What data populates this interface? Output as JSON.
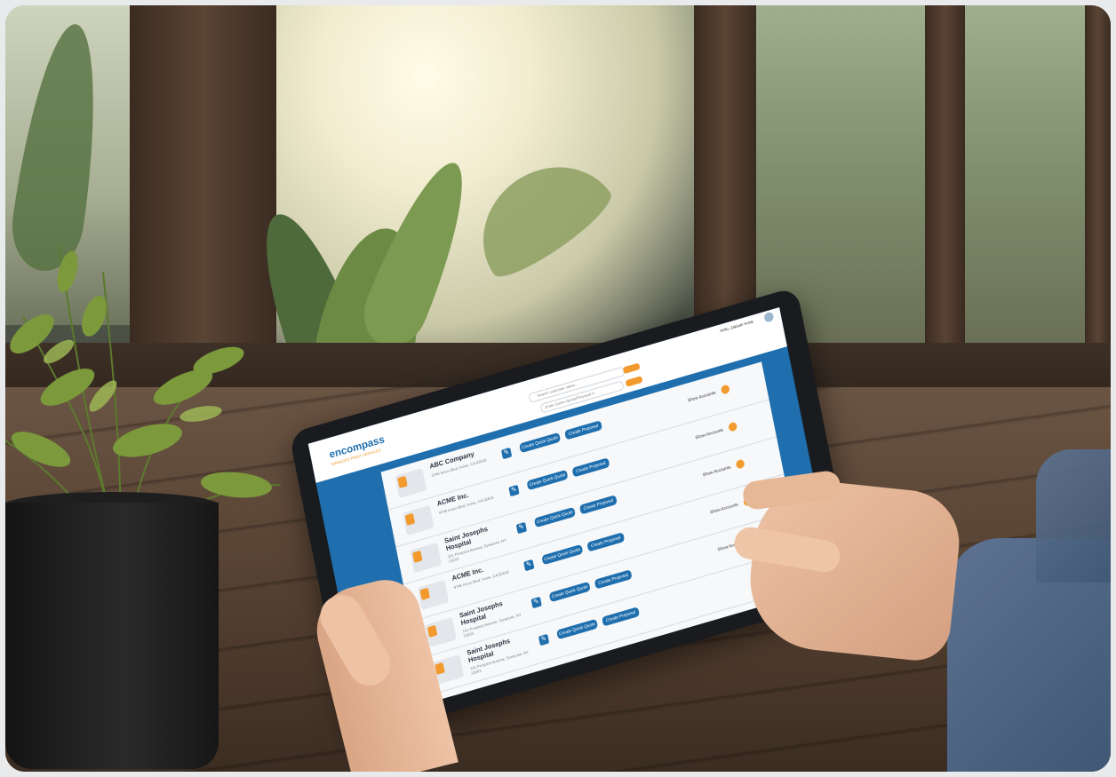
{
  "app": {
    "logo_text": "encompass",
    "logo_tagline": "MANAGED PRINT SERVICES",
    "greeting": "Hello, Zakiyah Holds",
    "search_placeholder": "Search customer name...",
    "quote_placeholder": "Enter Quote Quote/Proposal #..."
  },
  "customers": [
    {
      "name": "ABC Company",
      "address": "3745 Innox Blvd, Irvine, CA 92618"
    },
    {
      "name": "ACME Inc.",
      "address": "9745 Innox Blvd, Irvine, CA 92618"
    },
    {
      "name": "Saint Josephs Hospital",
      "address": "101 Prospect Avenue, Syracuse, NY 13203"
    },
    {
      "name": "ACME Inc.",
      "address": "9745 Innox Blvd, Irvine, CA 92618"
    },
    {
      "name": "Saint Josephs Hospital",
      "address": "101 Prospect Avenue, Syracuse, NY 13203"
    },
    {
      "name": "Saint Josephs Hospital",
      "address": "101 Prospect Avenue, Syracuse, NY 13203"
    }
  ],
  "actions": {
    "quick_quote": "Create Quick Quote",
    "proposal": "Create Proposal",
    "show_accounts": "Show Accounts"
  },
  "icons": [
    "edit-icon",
    "avatar-icon",
    "search-icon",
    "document-icon",
    "chevron-icon"
  ],
  "colors": {
    "brand_blue": "#1f6fae",
    "accent_orange": "#f29a2e"
  }
}
